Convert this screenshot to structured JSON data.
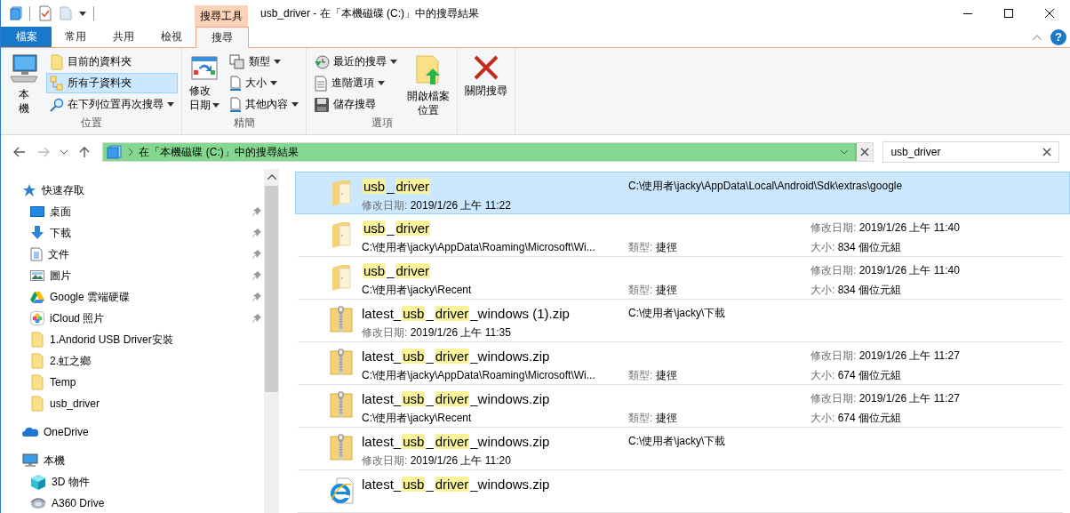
{
  "window": {
    "title": "usb_driver - 在「本機磁碟 (C:)」中的搜尋結果",
    "context_tab": "搜尋工具",
    "help": "?"
  },
  "tabs": [
    {
      "label": "檔案",
      "kind": "file",
      "selected": false
    },
    {
      "label": "常用",
      "kind": "tab",
      "selected": false
    },
    {
      "label": "共用",
      "kind": "tab",
      "selected": false
    },
    {
      "label": "檢視",
      "kind": "tab",
      "selected": false
    },
    {
      "label": "搜尋",
      "kind": "tab",
      "selected": true
    }
  ],
  "ribbon": {
    "groups": [
      {
        "label": "位置",
        "items": [
          {
            "kind": "computer",
            "label": "本機",
            "large": true,
            "dropdown": false,
            "selected": false
          },
          {
            "kind": "folder",
            "label": "目前的資料夾",
            "large": false,
            "dropdown": false,
            "selected": false
          },
          {
            "kind": "subfolders",
            "label": "所有子資料夾",
            "large": false,
            "dropdown": false,
            "selected": true
          },
          {
            "kind": "search-again",
            "label": "在下列位置再次搜尋",
            "large": false,
            "dropdown": true,
            "selected": false
          }
        ]
      },
      {
        "label": "精簡",
        "items": [
          {
            "kind": "calendar",
            "label": "修改日期",
            "large": true,
            "dropdown": true,
            "selected": false
          },
          {
            "kind": "type",
            "label": "類型",
            "large": false,
            "dropdown": true,
            "selected": false
          },
          {
            "kind": "size",
            "label": "大小",
            "large": false,
            "dropdown": true,
            "selected": false
          },
          {
            "kind": "props",
            "label": "其他內容",
            "large": false,
            "dropdown": true,
            "selected": false
          }
        ]
      },
      {
        "label": "選項",
        "items": [
          {
            "kind": "recent",
            "label": "最近的搜尋",
            "large": false,
            "dropdown": true,
            "selected": false
          },
          {
            "kind": "advanced",
            "label": "進階選項",
            "large": false,
            "dropdown": true,
            "selected": false
          },
          {
            "kind": "save",
            "label": "儲存搜尋",
            "large": false,
            "dropdown": false,
            "selected": false
          },
          {
            "kind": "open-location",
            "label": "開啟檔案位置",
            "large": true,
            "dropdown": false,
            "selected": false
          }
        ]
      },
      {
        "items": [
          {
            "kind": "close",
            "label": "關閉搜尋",
            "large": true,
            "dropdown": false,
            "selected": false
          }
        ]
      }
    ]
  },
  "address": {
    "location": "在「本機磁碟 (C:)」中的搜尋結果",
    "level": 1
  },
  "search": {
    "value": "usb_driver"
  },
  "navigation": [
    {
      "label": "快速存取",
      "kind": "star",
      "children": [
        {
          "label": "桌面",
          "kind": "desktop",
          "pinned": true
        },
        {
          "label": "下載",
          "kind": "download",
          "pinned": true
        },
        {
          "label": "文件",
          "kind": "document",
          "pinned": true
        },
        {
          "label": "圖片",
          "kind": "pictures",
          "pinned": true
        },
        {
          "label": "Google 雲端硬碟",
          "kind": "gdrive",
          "pinned": true
        },
        {
          "label": "iCloud 照片",
          "kind": "photos",
          "pinned": true
        },
        {
          "label": "1.Andorid USB Driver安裝",
          "kind": "folder",
          "pinned": false
        },
        {
          "label": "2.虹之鄉",
          "kind": "folder",
          "pinned": false
        },
        {
          "label": "Temp",
          "kind": "folder",
          "pinned": false
        },
        {
          "label": "usb_driver",
          "kind": "folder",
          "pinned": false
        }
      ]
    },
    {
      "label": "OneDrive",
      "kind": "cloud"
    },
    {
      "label": "本機",
      "kind": "computer",
      "children": [
        {
          "label": "3D 物件",
          "kind": "cube",
          "pinned": false
        },
        {
          "label": "A360 Drive",
          "kind": "a360",
          "pinned": false
        }
      ]
    }
  ],
  "results": [
    {
      "kind": "folder",
      "selected": true,
      "name": [
        {
          "text": "usb",
          "match": true
        },
        {
          "text": "_",
          "match": false
        },
        {
          "text": "driver",
          "match": true
        }
      ],
      "sub": {
        "label": "修改日期:",
        "value": "2019/1/26 上午 11:22"
      },
      "middle": {
        "top": {
          "value": "C:\\使用者\\jacky\\AppData\\Local\\Android\\Sdk\\extras\\google"
        }
      }
    },
    {
      "kind": "folder",
      "selected": false,
      "name": [
        {
          "text": "usb",
          "match": true
        },
        {
          "text": "_",
          "match": false
        },
        {
          "text": "driver",
          "match": true
        }
      ],
      "sub": {
        "value": "C:\\使用者\\jacky\\AppData\\Roaming\\Microsoft\\Wi..."
      },
      "middle": {
        "bottom": {
          "label": "類型:",
          "value": "捷徑"
        }
      },
      "right": {
        "top": {
          "label": "修改日期:",
          "value": "2019/1/26 上午 11:40"
        },
        "bottom": {
          "label": "大小:",
          "value": "834 個位元組"
        }
      }
    },
    {
      "kind": "folder",
      "selected": false,
      "name": [
        {
          "text": "usb",
          "match": true
        },
        {
          "text": "_",
          "match": false
        },
        {
          "text": "driver",
          "match": true
        }
      ],
      "sub": {
        "value": "C:\\使用者\\jacky\\Recent"
      },
      "middle": {
        "bottom": {
          "label": "類型:",
          "value": "捷徑"
        }
      },
      "right": {
        "top": {
          "label": "修改日期:",
          "value": "2019/1/26 上午 11:40"
        },
        "bottom": {
          "label": "大小:",
          "value": "834 個位元組"
        }
      }
    },
    {
      "kind": "zip",
      "selected": false,
      "name": [
        {
          "text": "latest_",
          "match": false
        },
        {
          "text": "usb",
          "match": true
        },
        {
          "text": "_",
          "match": false
        },
        {
          "text": "driver",
          "match": true
        },
        {
          "text": "_windows (1).zip",
          "match": false
        }
      ],
      "sub": {
        "label": "修改日期:",
        "value": "2019/1/26 上午 11:35"
      },
      "middle": {
        "top": {
          "value": "C:\\使用者\\jacky\\下載"
        }
      }
    },
    {
      "kind": "zip",
      "selected": false,
      "name": [
        {
          "text": "latest_",
          "match": false
        },
        {
          "text": "usb",
          "match": true
        },
        {
          "text": "_",
          "match": false
        },
        {
          "text": "driver",
          "match": true
        },
        {
          "text": "_windows.zip",
          "match": false
        }
      ],
      "sub": {
        "value": "C:\\使用者\\jacky\\AppData\\Roaming\\Microsoft\\Wi..."
      },
      "middle": {
        "bottom": {
          "label": "類型:",
          "value": "捷徑"
        }
      },
      "right": {
        "top": {
          "label": "修改日期:",
          "value": "2019/1/26 上午 11:27"
        },
        "bottom": {
          "label": "大小:",
          "value": "674 個位元組"
        }
      }
    },
    {
      "kind": "zip",
      "selected": false,
      "name": [
        {
          "text": "latest_",
          "match": false
        },
        {
          "text": "usb",
          "match": true
        },
        {
          "text": "_",
          "match": false
        },
        {
          "text": "driver",
          "match": true
        },
        {
          "text": "_windows.zip",
          "match": false
        }
      ],
      "sub": {
        "value": "C:\\使用者\\jacky\\Recent"
      },
      "middle": {
        "bottom": {
          "label": "類型:",
          "value": "捷徑"
        }
      },
      "right": {
        "top": {
          "label": "修改日期:",
          "value": "2019/1/26 上午 11:27"
        },
        "bottom": {
          "label": "大小:",
          "value": "674 個位元組"
        }
      }
    },
    {
      "kind": "zip",
      "selected": false,
      "name": [
        {
          "text": "latest_",
          "match": false
        },
        {
          "text": "usb",
          "match": true
        },
        {
          "text": "_",
          "match": false
        },
        {
          "text": "driver",
          "match": true
        },
        {
          "text": "_windows.zip",
          "match": false
        }
      ],
      "sub": {
        "label": "修改日期:",
        "value": "2019/1/26 上午 11:20"
      },
      "middle": {
        "top": {
          "value": "C:\\使用者\\jacky\\下載"
        }
      }
    },
    {
      "kind": "web",
      "selected": false,
      "name": [
        {
          "text": "latest_",
          "match": false
        },
        {
          "text": "usb",
          "match": true
        },
        {
          "text": "_",
          "match": false
        },
        {
          "text": "driver",
          "match": true
        },
        {
          "text": "_windows.zip",
          "match": false
        }
      ]
    }
  ]
}
